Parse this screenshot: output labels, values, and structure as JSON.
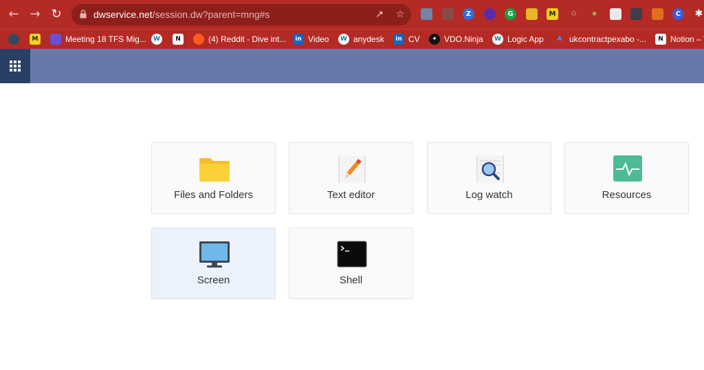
{
  "browser": {
    "url_host": "dwservice.net",
    "url_path": "/session.dw?parent=mng#s",
    "bookmarks": [
      {
        "label": ""
      },
      {
        "label": ""
      },
      {
        "label": "Meeting 18 TFS Mig..."
      },
      {
        "label": ""
      },
      {
        "label": ""
      },
      {
        "label": "(4) Reddit - Dive int..."
      },
      {
        "label": "Video"
      },
      {
        "label": "anydesk"
      },
      {
        "label": "CV"
      },
      {
        "label": "VDO.Ninja"
      },
      {
        "label": "Logic App"
      },
      {
        "label": "ukcontractpexabo -..."
      },
      {
        "label": "Notion – T"
      }
    ],
    "extension_letters": {
      "z": "Z",
      "g": "G",
      "c": "C"
    }
  },
  "tools": [
    {
      "label": "Files and Folders"
    },
    {
      "label": "Text editor"
    },
    {
      "label": "Log watch"
    },
    {
      "label": "Resources"
    },
    {
      "label": "Screen"
    },
    {
      "label": "Shell"
    }
  ],
  "colors": {
    "chrome": "#b42a25",
    "app_bar": "#6879a9",
    "apps_button": "#2a3f66",
    "tile_selected": "#ebf2fc"
  }
}
